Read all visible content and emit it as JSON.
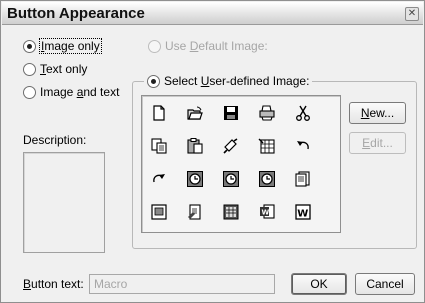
{
  "window": {
    "title": "Button Appearance",
    "close_glyph": "✕"
  },
  "appearance_options": [
    {
      "label_pre": "",
      "label_u": "I",
      "label_post": "mage only",
      "checked": true
    },
    {
      "label_pre": "",
      "label_u": "T",
      "label_post": "ext only",
      "checked": false
    },
    {
      "label_pre": "Image ",
      "label_u": "a",
      "label_post": "nd text",
      "checked": false
    }
  ],
  "image_source": {
    "default": {
      "label_pre": "Use ",
      "label_u": "D",
      "label_post": "efault Image:",
      "checked": false,
      "enabled": false
    },
    "user": {
      "label_pre": "Select ",
      "label_u": "U",
      "label_post": "ser-defined Image:",
      "checked": true,
      "enabled": true
    }
  },
  "description": {
    "label": "Description:",
    "value": ""
  },
  "icons": [
    [
      "new-document-icon",
      "open-folder-icon",
      "save-disk-icon",
      "print-icon",
      "cut-scissors-icon"
    ],
    [
      "copy-icon",
      "paste-icon",
      "format-painter-icon",
      "insert-table-icon",
      "undo-icon"
    ],
    [
      "redo-icon",
      "clock-icon",
      "clock-icon",
      "clock-icon",
      "page-icon"
    ],
    [
      "picture-page-icon",
      "document-pen-icon",
      "spreadsheet-icon",
      "word-document-icon",
      "word-logo-icon"
    ]
  ],
  "buttons": {
    "new": {
      "pre": "",
      "u": "N",
      "post": "ew..."
    },
    "edit": {
      "pre": "",
      "u": "E",
      "post": "dit...",
      "enabled": false
    },
    "ok": "OK",
    "cancel": "Cancel"
  },
  "button_text": {
    "label_pre": "",
    "label_u": "B",
    "label_post": "utton text:",
    "value": "Macro"
  }
}
